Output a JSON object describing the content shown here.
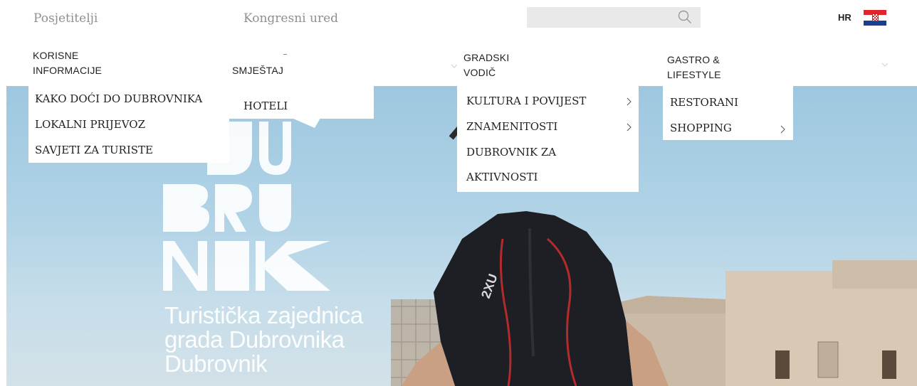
{
  "top_bar": {
    "links": [
      "Posjetitelji",
      "Kongresni ured"
    ],
    "search": {
      "value": "",
      "placeholder": ""
    },
    "language": "HR",
    "flag_colors": [
      "#e2242b",
      "#ffffff",
      "#1b3e93"
    ]
  },
  "nav": {
    "items": [
      {
        "label_line1": "KORISNE",
        "label_line2": "INFORMACIJE"
      },
      {
        "label_line1": "SMJEŠTAJ",
        "label_line2": ""
      },
      {
        "label_line1": "GRADSKI",
        "label_line2": "VODIČ"
      },
      {
        "label_line1": "GASTRO &",
        "label_line2": "LIFESTYLE"
      }
    ]
  },
  "dropdowns": {
    "korisne_informacije": [
      "KAKO DOĆI DO DUBROVNIKA",
      "LOKALNI PRIJEVOZ",
      "SAVJETI ZA TURISTE"
    ],
    "smjestaj": [
      "HOTELI"
    ],
    "gradski_vodic": [
      "KULTURA I POVIJEST",
      "ZNAMENITOSTI",
      "DUBROVNIK ZA",
      "AKTIVNOSTI"
    ],
    "gastro_lifestyle": [
      "RESTORANI",
      "SHOPPING"
    ]
  },
  "hero": {
    "logo_text": "DUBROVNIK",
    "tagline_line1": "Turistička zajednica",
    "tagline_line2": "grada Dubrovnika",
    "tagline_line3": "Dubrovnik"
  },
  "colors": {
    "sky": "#a9cfe4",
    "wetsuit": "#1d1f24",
    "wetsuit_stripe": "#b32b2b",
    "stone": "#c9b9a8"
  },
  "icons": [
    "search-icon",
    "chevron-down-icon",
    "chevron-right-icon",
    "croatia-flag-icon"
  ]
}
